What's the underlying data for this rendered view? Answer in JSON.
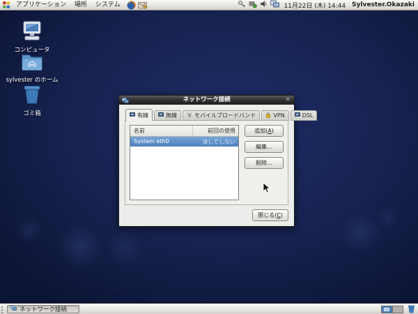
{
  "top_panel": {
    "menus": [
      {
        "label": "アプリケーション"
      },
      {
        "label": "場所"
      },
      {
        "label": "システム"
      }
    ],
    "clock": "11月22日 (木) 14:44",
    "username": "Sylvester.Okazaki"
  },
  "desktop": {
    "icons": [
      {
        "label": "コンピュータ"
      },
      {
        "label": "sylvester のホーム"
      },
      {
        "label": "ゴミ箱"
      }
    ]
  },
  "dialog": {
    "title": "ネットワーク接続",
    "close_glyph": "×",
    "tabs": [
      {
        "label": "有線",
        "active": true
      },
      {
        "label": "無線",
        "active": false
      },
      {
        "label": "モバイルブロードバンド",
        "active": false
      },
      {
        "label": "VPN",
        "active": false
      },
      {
        "label": "DSL",
        "active": false
      }
    ],
    "table": {
      "columns": [
        "名前",
        "前回の使用"
      ],
      "rows": [
        {
          "name": "System eth0",
          "last_used": "決してしない",
          "selected": true
        }
      ]
    },
    "buttons": {
      "add": {
        "pre": "追加(",
        "key": "A",
        "post": ")"
      },
      "edit": "編集...",
      "delete": "削除...",
      "close": {
        "pre": "閉じる(",
        "key": "C",
        "post": ")"
      }
    }
  },
  "taskbar": {
    "tasks": [
      {
        "label": "ネットワーク接続",
        "active": true
      }
    ],
    "workspace_count": 2,
    "active_workspace": 1
  },
  "colors": {
    "selection_blue": "#5a90ce",
    "desktop_navy": "#16224f",
    "panel_gray": "#e6e3de",
    "titlebar_dark": "#2d2d2d",
    "vpn_lock_yellow": "#e8b820"
  }
}
